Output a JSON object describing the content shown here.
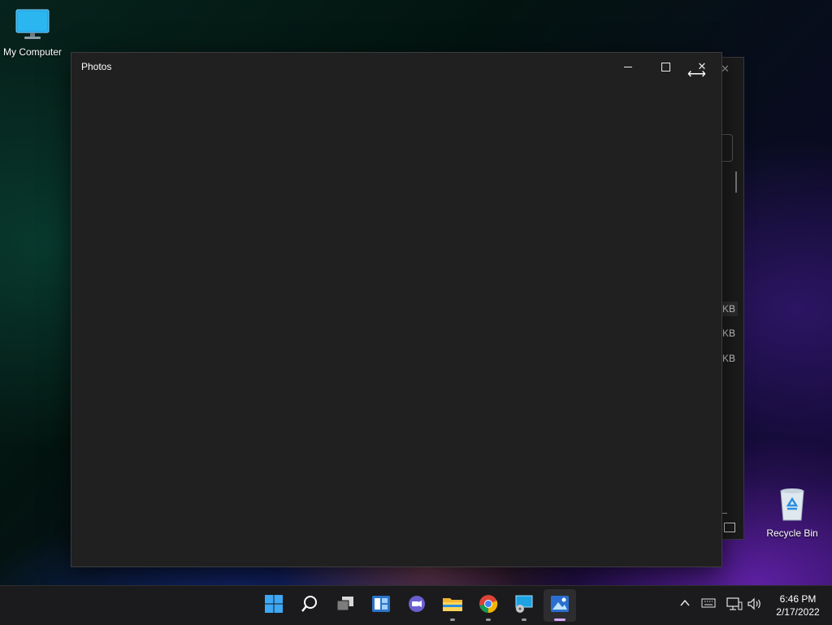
{
  "desktop": {
    "icons": [
      {
        "label": "My Computer",
        "icon": "monitor-icon"
      },
      {
        "label": "Recycle Bin",
        "icon": "recycle-bin-icon"
      }
    ]
  },
  "background_window": {
    "size_labels": [
      "KB",
      "KB",
      "KB"
    ]
  },
  "photos_window": {
    "title": "Photos",
    "controls": {
      "minimize": "minimize-icon",
      "maximize": "maximize-icon",
      "close": "close-icon"
    }
  },
  "taskbar": {
    "apps": [
      {
        "name": "Start",
        "icon": "windows-start-icon"
      },
      {
        "name": "Search",
        "icon": "search-icon"
      },
      {
        "name": "Task View",
        "icon": "task-view-icon"
      },
      {
        "name": "Widgets",
        "icon": "widgets-icon"
      },
      {
        "name": "Chat",
        "icon": "chat-icon"
      },
      {
        "name": "File Explorer",
        "icon": "folder-icon"
      },
      {
        "name": "Google Chrome",
        "icon": "chrome-icon"
      },
      {
        "name": "Disk Management",
        "icon": "disk-icon"
      },
      {
        "name": "Photos",
        "icon": "photos-icon"
      }
    ],
    "tray": {
      "time": "6:46 PM",
      "date": "2/17/2022"
    }
  },
  "colors": {
    "window_bg": "#202020",
    "taskbar_bg": "#1b1b1d",
    "active_indicator": "#d7a6ff"
  }
}
